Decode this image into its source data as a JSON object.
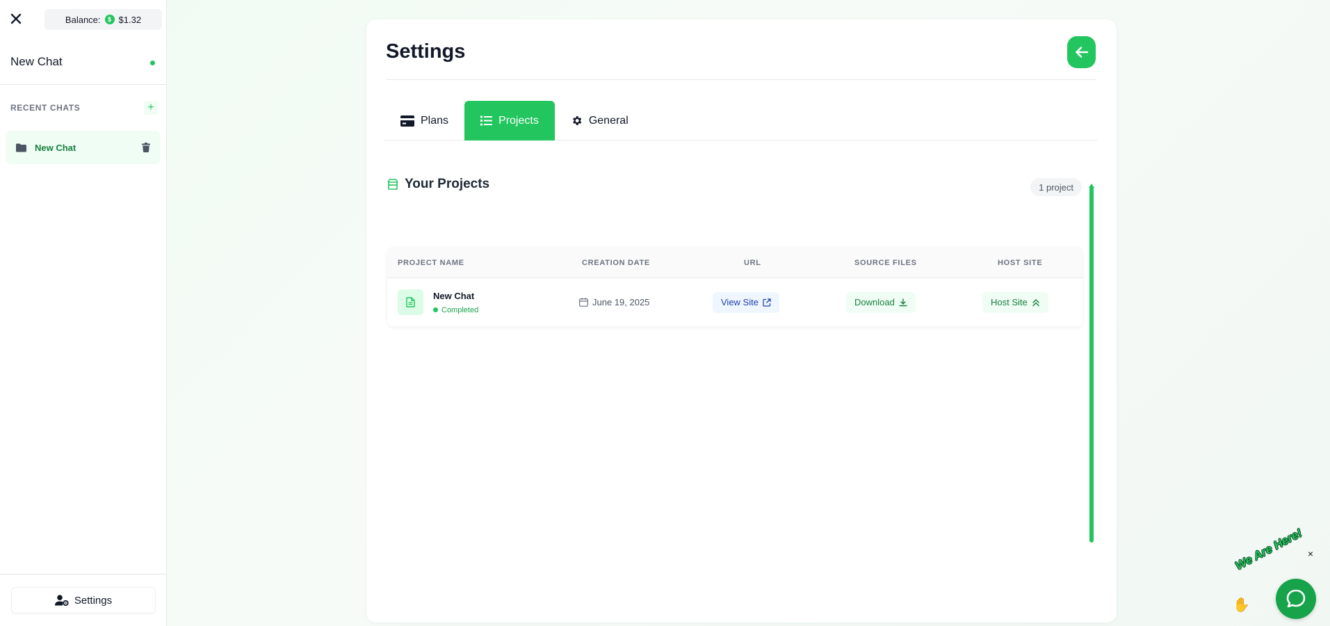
{
  "sidebar": {
    "balance_label": "Balance:",
    "balance_value": "$1.32",
    "coin_symbol": "$",
    "chat_title": "New Chat",
    "recent_label": "RECENT CHATS",
    "add_symbol": "+",
    "chats": [
      {
        "label": "New Chat"
      }
    ],
    "settings_label": "Settings"
  },
  "main": {
    "title": "Settings",
    "tabs": [
      {
        "label": "Plans",
        "icon": "credit-card-icon"
      },
      {
        "label": "Projects",
        "icon": "list-icon",
        "active": true
      },
      {
        "label": "General",
        "icon": "gear-icon"
      }
    ],
    "section_title": "Your Projects",
    "count_badge": "1 project",
    "table": {
      "columns": [
        "PROJECT NAME",
        "CREATION DATE",
        "URL",
        "SOURCE FILES",
        "HOST SITE"
      ],
      "rows": [
        {
          "name": "New Chat",
          "status": "Completed",
          "date": "June 19, 2025",
          "url_label": "View Site",
          "download_label": "Download",
          "host_label": "Host Site"
        }
      ]
    }
  },
  "widget": {
    "text": "We Are Here!",
    "close_symbol": "×"
  },
  "colors": {
    "accent": "#22c55e",
    "accent_dark": "#16a34a",
    "link_blue": "#1e40af"
  }
}
